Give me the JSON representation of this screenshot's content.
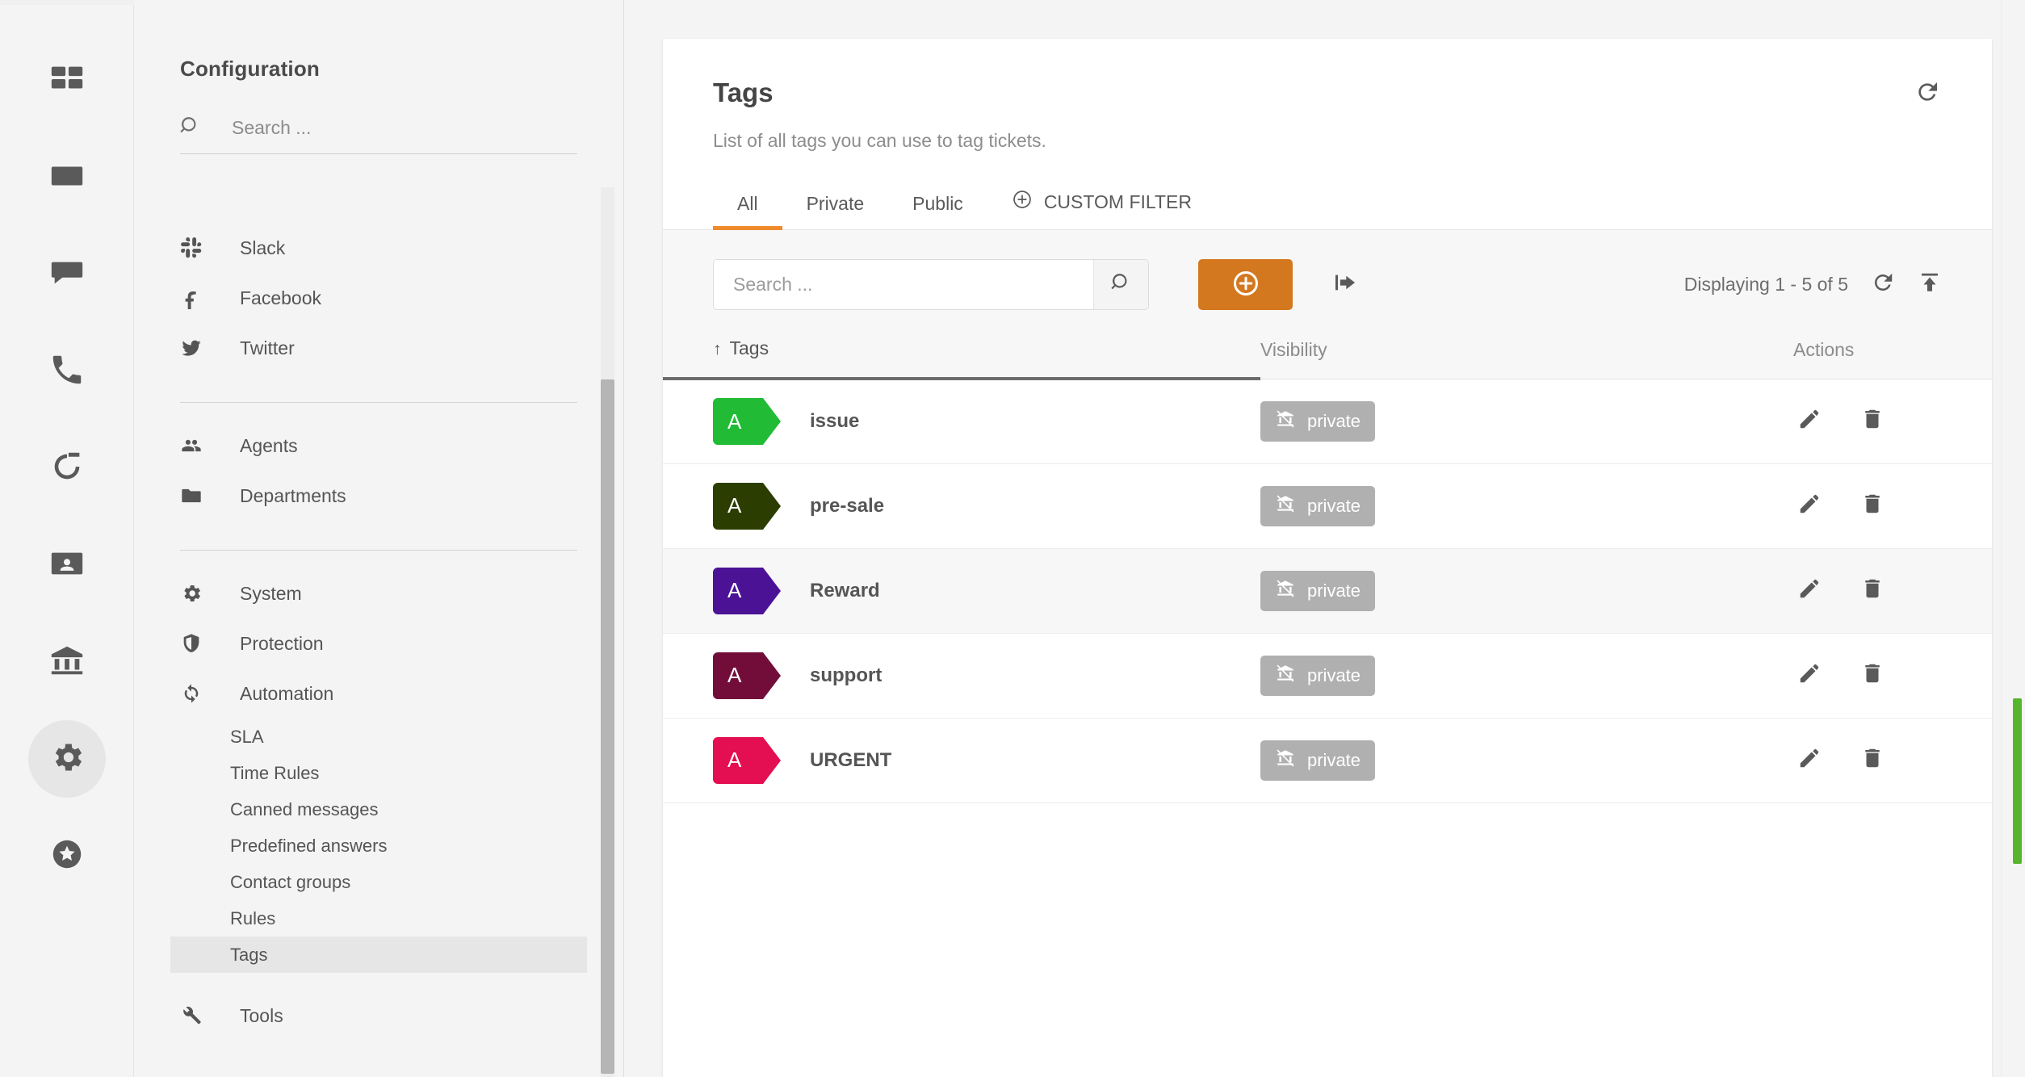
{
  "rail": {
    "items": [
      {
        "name": "dashboard-icon",
        "label": "Dashboard",
        "active": false
      },
      {
        "name": "mail-icon",
        "label": "Mail",
        "active": false
      },
      {
        "name": "chat-icon",
        "label": "Chat",
        "active": false
      },
      {
        "name": "phone-icon",
        "label": "Calls",
        "active": false
      },
      {
        "name": "activity-icon",
        "label": "Activity",
        "active": false
      },
      {
        "name": "contact-card-icon",
        "label": "Contacts",
        "active": false
      },
      {
        "name": "bank-icon",
        "label": "Accounts",
        "active": false
      },
      {
        "name": "gear-icon",
        "label": "Settings",
        "active": true
      },
      {
        "name": "star-badge-icon",
        "label": "Favorites",
        "active": false
      }
    ]
  },
  "config": {
    "title": "Configuration",
    "search_placeholder": "Search ...",
    "search_value": "",
    "groups": [
      {
        "clipped_top": true,
        "items": [
          {
            "label": "Slack",
            "icon": "slack-icon",
            "type": "item"
          },
          {
            "label": "Facebook",
            "icon": "facebook-icon",
            "type": "item"
          },
          {
            "label": "Twitter",
            "icon": "twitter-icon",
            "type": "item"
          }
        ]
      },
      {
        "clipped_top": false,
        "items": [
          {
            "label": "Agents",
            "icon": "people-icon",
            "type": "item"
          },
          {
            "label": "Departments",
            "icon": "folder-icon",
            "type": "item"
          }
        ]
      },
      {
        "clipped_top": false,
        "items": [
          {
            "label": "System",
            "icon": "gear-icon",
            "type": "item"
          },
          {
            "label": "Protection",
            "icon": "shield-icon",
            "type": "item"
          },
          {
            "label": "Automation",
            "icon": "sync-icon",
            "type": "item"
          },
          {
            "label": "SLA",
            "type": "sub",
            "selected": false
          },
          {
            "label": "Time Rules",
            "type": "sub",
            "selected": false
          },
          {
            "label": "Canned messages",
            "type": "sub",
            "selected": false
          },
          {
            "label": "Predefined answers",
            "type": "sub",
            "selected": false
          },
          {
            "label": "Contact groups",
            "type": "sub",
            "selected": false
          },
          {
            "label": "Rules",
            "type": "sub",
            "selected": false
          },
          {
            "label": "Tags",
            "type": "sub",
            "selected": true
          },
          {
            "label": "Tools",
            "icon": "wrench-icon",
            "type": "item"
          }
        ]
      }
    ]
  },
  "page": {
    "title": "Tags",
    "subtitle": "List of all tags you can use to tag tickets.",
    "refresh_icon": "refresh-icon"
  },
  "tabs": [
    {
      "label": "All",
      "active": true
    },
    {
      "label": "Private",
      "active": false
    },
    {
      "label": "Public",
      "active": false
    },
    {
      "label": "CUSTOM FILTER",
      "active": false,
      "icon": "plus-circle-icon"
    }
  ],
  "toolbar": {
    "search_placeholder": "Search ...",
    "search_value": "",
    "search_icon": "search-icon",
    "add_icon": "plus-circle-icon",
    "add_color": "#d4781f",
    "export_icon": "export-arrow-icon",
    "displaying": "Displaying 1 - 5 of 5",
    "refresh_icon": "refresh-icon",
    "upload_icon": "upload-icon"
  },
  "table": {
    "columns": [
      {
        "key": "tags",
        "label": "Tags",
        "sorted": true,
        "sort_dir": "↑"
      },
      {
        "key": "visibility",
        "label": "Visibility",
        "sorted": false
      },
      {
        "key": "actions",
        "label": "Actions",
        "sorted": false
      }
    ],
    "rows": [
      {
        "initial": "A",
        "color": "#21bb36",
        "name": "issue",
        "visibility": "private",
        "vis_icon": "bank-off-icon",
        "edit_icon": "pencil-icon",
        "delete_icon": "trash-icon"
      },
      {
        "initial": "A",
        "color": "#2b3d00",
        "name": "pre-sale",
        "visibility": "private",
        "vis_icon": "bank-off-icon",
        "edit_icon": "pencil-icon",
        "delete_icon": "trash-icon"
      },
      {
        "initial": "A",
        "color": "#4b1296",
        "name": "Reward",
        "visibility": "private",
        "vis_icon": "bank-off-icon",
        "edit_icon": "pencil-icon",
        "delete_icon": "trash-icon"
      },
      {
        "initial": "A",
        "color": "#720d3a",
        "name": "support",
        "visibility": "private",
        "vis_icon": "bank-off-icon",
        "edit_icon": "pencil-icon",
        "delete_icon": "trash-icon"
      },
      {
        "initial": "A",
        "color": "#e40e52",
        "name": "URGENT",
        "visibility": "private",
        "vis_icon": "bank-off-icon",
        "edit_icon": "pencil-icon",
        "delete_icon": "trash-icon"
      }
    ]
  },
  "scrollbars": {
    "right_thumb_color": "#55b62b"
  }
}
